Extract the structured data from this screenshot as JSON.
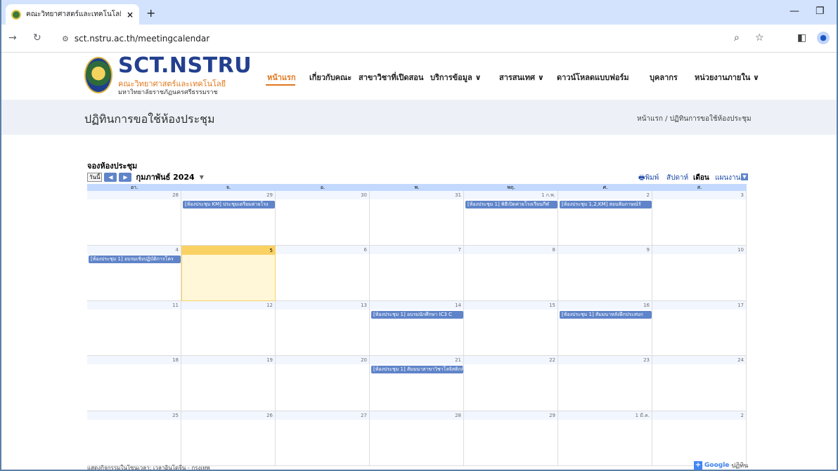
{
  "browser": {
    "tab_title": "คณะวิทยาศาสตร์และเทคโนโลยี มหาวิ",
    "tab_close": "×",
    "new_tab": "+",
    "url": "sct.nstru.ac.th/meetingcalendar"
  },
  "site": {
    "logo_title": "SCT.NSTRU",
    "logo_sub1": "คณะวิทยาศาสตร์และเทคโนโลยี",
    "logo_sub2": "มหาวิทยาลัยราชภัฏนครศรีธรรมราช",
    "menu": [
      {
        "label": "หน้าแรก"
      },
      {
        "label": "เกี่ยวกับคณะ"
      },
      {
        "label": "สาขาวิชาที่เปิดสอน"
      },
      {
        "label": "บริการข้อมูล ∨"
      },
      {
        "label": "สารสนเทศ ∨"
      },
      {
        "label": "ดาวน์โหลดแบบฟอร์ม"
      },
      {
        "label": "บุคลากร"
      },
      {
        "label": "หน่วยงานภายใน ∨"
      }
    ]
  },
  "page": {
    "title": "ปฏิทินการขอใช้ห้องประชุม",
    "breadcrumb": "หน้าแรก / ปฏิทินการขอใช้ห้องประชุม"
  },
  "calendar": {
    "heading": "จองห้องประชุม",
    "today_btn": "วันนี้",
    "prev": "◀",
    "next": "▶",
    "current_month": "กุมภาพันธ์ 2024",
    "caret": "▼",
    "print": "🖶พิมพ์",
    "view_week": "สัปดาห์",
    "view_month": "เดือน",
    "view_agenda": "แผนงาน",
    "dropdown": "▼",
    "dow": [
      "อา.",
      "จ.",
      "อ.",
      "พ.",
      "พฤ.",
      "ศ.",
      "ส."
    ],
    "weeks": [
      [
        "28",
        "29",
        "30",
        "31",
        "1 ก.พ.",
        "2",
        "3"
      ],
      [
        "4",
        "5",
        "6",
        "7",
        "8",
        "9",
        "10"
      ],
      [
        "11",
        "12",
        "13",
        "14",
        "15",
        "16",
        "17"
      ],
      [
        "18",
        "19",
        "20",
        "21",
        "22",
        "23",
        "24"
      ],
      [
        "25",
        "26",
        "27",
        "28",
        "29",
        "1 มี.ค.",
        "2"
      ]
    ],
    "events": [
      {
        "week": 0,
        "day": 1,
        "text": "[ห้องประชุม KM] ประชุมเตรียมค่ายโรง"
      },
      {
        "week": 0,
        "day": 4,
        "text": "[ห้องประชุม 1] พิธีเปิดค่ายโรงเรียนกีฬ"
      },
      {
        "week": 0,
        "day": 5,
        "text": "[ห้องประชุม 1,2,KM] สอบสัมภาษณ์รั"
      },
      {
        "week": 1,
        "day": 0,
        "text": "[ห้องประชุม 1] อบรมเชิงปฏิบัติการโคร"
      },
      {
        "week": 2,
        "day": 3,
        "text": "[ห้องประชุม 1] อบรมนักศึกษา IC3 C"
      },
      {
        "week": 2,
        "day": 5,
        "text": "[ห้องประชุม 1] สัมมนาหลังฝึกประสบก"
      },
      {
        "week": 3,
        "day": 3,
        "text": "[ห้องประชุม 1] สัมมนาสาขาวิชาโลจิสติกส์"
      }
    ],
    "footer": "แสดงกิจกรรมในโซนเวลา: เวลาอินโดจีน - กรุงเทพ",
    "google_plus": "+",
    "google_label": "Google",
    "google_suffix": "ปฏิทิน"
  }
}
